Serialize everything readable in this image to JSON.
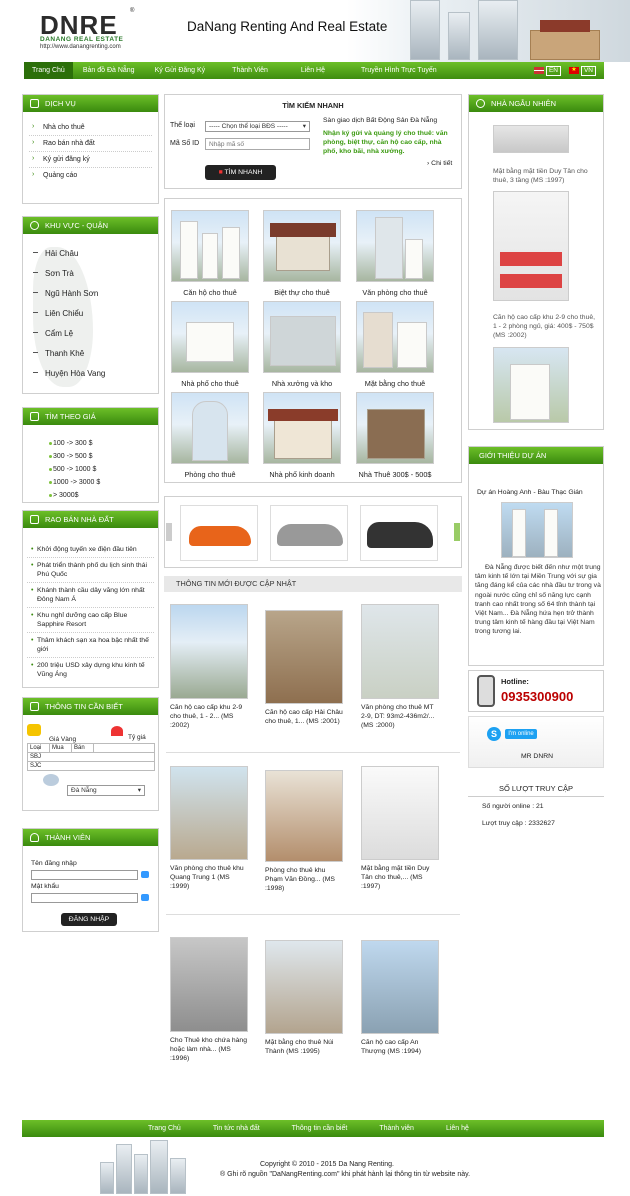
{
  "header": {
    "logo": "DNRE",
    "logo_sub": "DANANG REAL ESTATE",
    "logo_url": "http://www.danangrenting.com",
    "title": "DaNang Renting And Real Estate"
  },
  "topnav": {
    "items": [
      "Trang Chủ",
      "Bản đồ Đà Nẵng",
      "Ký Gửi Đăng Ký",
      "Thành Viên",
      "Liên Hệ",
      "Truyền Hình Trực Tuyến"
    ],
    "lang_en": "EN",
    "lang_vn": "VN"
  },
  "services": {
    "title": "DỊCH VỤ",
    "items": [
      "Nhà cho thuê",
      "Rao bán nhà đất",
      "Ký gửi đăng ký",
      "Quảng cáo"
    ]
  },
  "districts": {
    "title": "KHU VỰC - QUẬN",
    "items": [
      "Hải Châu",
      "Sơn Trà",
      "Ngũ Hành Sơn",
      "Liên Chiểu",
      "Cẩm Lệ",
      "Thanh Khê",
      "Huyện Hòa Vang"
    ]
  },
  "price": {
    "title": "TÌM THEO GIÁ",
    "items": [
      "100     -> 300 $",
      "300     -> 500 $",
      "500     -> 1000 $",
      "1000    -> 3000 $",
      "> 3000$"
    ]
  },
  "sale": {
    "title": "RAO BÁN NHÀ ĐẤT",
    "items": [
      "Khởi động tuyến xe điện đầu tiên",
      "Phát triển thành phố du lịch sinh thái Phú Quốc",
      "Khánh thành cầu dây văng lớn nhất Đông Nam Á",
      "Khu nghỉ dưỡng cao cấp Blue Sapphire Resort",
      "Thâm khách sạn xa hoa bậc nhất thế giới",
      "200 triệu USD xây dựng khu kinh tế Vũng Áng"
    ]
  },
  "info": {
    "title": "THÔNG TIN CẦN BIẾT",
    "gold": "Giá Vàng",
    "rate": "Tỷ giá",
    "cols": [
      "Loại",
      "Mua",
      "Bán"
    ],
    "rows": [
      "SBJ",
      "SJC"
    ],
    "city": "Đà Nẵng"
  },
  "member": {
    "title": "THÀNH VIÊN",
    "user_label": "Tên đăng nhập",
    "pass_label": "Mật khẩu",
    "login": "ĐĂNG NHẬP"
  },
  "search": {
    "title": "TÌM KIẾM NHANH",
    "type_label": "Thể loại",
    "type_value": "----- Chọn thể loại BĐS -----",
    "id_label": "Mã Số ID",
    "id_placeholder": "Nhập mã số",
    "button": "TÌM NHANH",
    "promo_title": "Sàn giao dịch Bất Động Sản Đà Nẵng",
    "promo_text": "Nhận ký gửi và quảng lý cho thuê: văn phòng, biệt thự, căn hộ cao cấp, nhà phố, kho bãi, nhà xưởng.",
    "more": "Chi tiết"
  },
  "categories": [
    "Căn hộ cho thuê",
    "Biệt thự cho thuê",
    "Văn phòng cho thuê",
    "Nhà phố cho thuê",
    "Nhà xưởng và kho",
    "Mặt bằng cho thuê",
    "Phòng cho thuê",
    "Nhà phố kinh doanh",
    "Nhà Thuê 300$ - 500$"
  ],
  "latest": {
    "title": "THÔNG TIN MỚI ĐƯỢC CẬP NHẬT",
    "items": [
      "Căn hộ cao cấp khu 2-9 cho thuê, 1 - 2... (MS :2002)",
      "Căn hộ cao cấp Hải Châu cho thuê, 1... (MS :2001)",
      "Văn phòng cho thuê MT 2-9, DT: 93m2-436m2/... (MS :2000)",
      "Văn phòng cho thuê khu Quang Trung 1 (MS :1999)",
      "Phòng cho thuê khu Phạm Văn Đồng... (MS :1998)",
      "Mặt bằng mặt tiền Duy Tân cho thuê,... (MS :1997)",
      "Cho Thuê kho chứa hàng hoặc làm nhà... (MS :1996)",
      "Mặt bằng cho thuê Núi Thành (MS :1995)",
      "Căn hộ cao cấp An Thượng (MS :1994)"
    ]
  },
  "random": {
    "title": "NHÀ NGẪU NHIÊN",
    "items": [
      "Mặt bằng mặt tiền Duy Tân cho thuê, 3 tầng (MS :1997)",
      "Căn hộ cao cấp khu 2-9 cho thuê, 1 - 2 phòng ngủ, giá: 400$ - 750$ (MS :2002)"
    ]
  },
  "project": {
    "title": "GIỚI THIỆU DỰ ÁN",
    "name": "Dự án Hoàng Anh - Bàu Thạc Gián",
    "text": "Đà Nẵng được biết đến như một trung tâm kinh tế lớn tại Miền Trung với sự gia tăng đáng kể của các nhà đầu tư trong và ngoài nước cũng chỉ số năng lực cạnh tranh cao nhất trong số 64 tỉnh thành tại Việt Nam... Đà Nẵng hứa hẹn trở thành trung tâm kinh tế hàng đầu tại Việt Nam trong tương lai."
  },
  "hotline": {
    "label": "Hotline:",
    "number": "0935300900"
  },
  "skype": {
    "status": "I'm online",
    "name": "MR DNRN"
  },
  "stats": {
    "title": "SỐ LƯỢT TRUY CẬP",
    "online": "Số người online : 21",
    "total": "Lượt truy cập : 2332627"
  },
  "footer": {
    "items": [
      "Trang Chủ",
      "Tin tức nhà đất",
      "Thông tin cần biết",
      "Thành viên",
      "Liên hệ"
    ],
    "copy1": "Copyright © 2010 - 2015 Da Nang Renting.",
    "copy2": "® Ghi rõ nguồn \"DaNangRenting.com\" khi phát hành lại thông tin từ website này."
  }
}
